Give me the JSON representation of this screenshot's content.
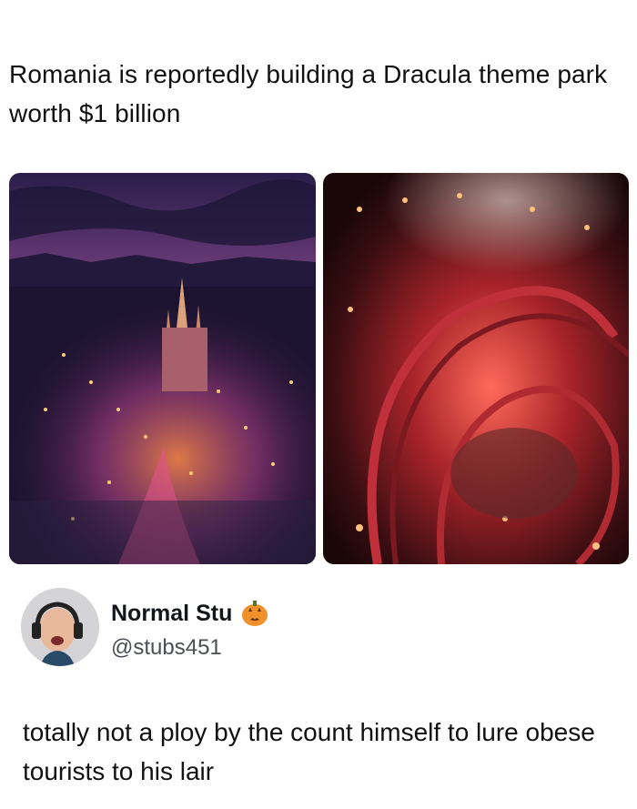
{
  "post": {
    "headline": "Romania is reportedly building a Dracula theme park worth $1 billion"
  },
  "images": {
    "left": {
      "subject": "castle theme park at dusk aerial view"
    },
    "right": {
      "subject": "red-lit roller coaster inside gothic hall"
    }
  },
  "tweet": {
    "display_name": "Normal Stu",
    "handle": "@stubs451",
    "name_emoji_icon": "jack-o-lantern-icon",
    "text": "totally not a ploy by the count himself to lure obese tourists to his lair"
  },
  "colors": {
    "text": "#111111",
    "handle": "#4a4f55",
    "pumpkin": "#f0902a"
  }
}
